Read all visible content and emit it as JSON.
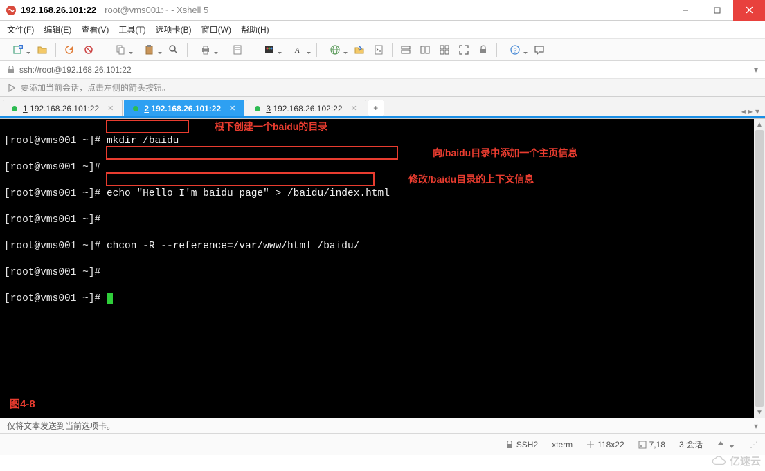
{
  "title": {
    "ip": "192.168.26.101:22",
    "sub": "root@vms001:~ - Xshell 5"
  },
  "menu": {
    "file": "文件(F)",
    "edit": "编辑(E)",
    "view": "查看(V)",
    "tools": "工具(T)",
    "tab": "选项卡(B)",
    "window": "窗口(W)",
    "help": "帮助(H)"
  },
  "addr": {
    "url": "ssh://root@192.168.26.101:22"
  },
  "hint": {
    "text": "要添加当前会话，点击左侧的箭头按钮。"
  },
  "tabs": [
    {
      "num": "1",
      "label": "192.168.26.101:22",
      "active": false
    },
    {
      "num": "2",
      "label": "192.168.26.101:22",
      "active": true
    },
    {
      "num": "3",
      "label": "192.168.26.102:22",
      "active": false
    }
  ],
  "terminal": {
    "prompt": "[root@vms001 ~]#",
    "cmd1": "mkdir /baidu",
    "cmd2": "echo \"Hello I'm baidu page\" > /baidu/index.html",
    "cmd3": "chcon -R --reference=/var/www/html /baidu/",
    "note1": "根下创建一个baidu的目录",
    "note2": "向/baidu目录中添加一个主页信息",
    "note3": "修改/baidu目录的上下文信息",
    "figure": "图4-8"
  },
  "footer": {
    "text": "仅将文本发送到当前选项卡。"
  },
  "status": {
    "proto": "SSH2",
    "term": "xterm",
    "size": "118x22",
    "pos": "7,18",
    "sess": "3 会话"
  },
  "watermark": "亿速云"
}
